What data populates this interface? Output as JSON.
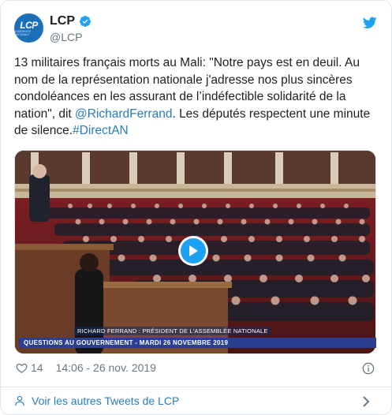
{
  "author": {
    "display_name": "LCP",
    "handle": "@LCP",
    "avatar_text": "LCP",
    "avatar_subtext": "assemblée nationale"
  },
  "tweet": {
    "text_before_mention": "13 militaires français morts au Mali: \"Notre pays est en deuil. Au nom de la représentation nationale j'adresse nos plus sincères condoléances en les assurant de l’indéfectible solidarité de la nation\", dit ",
    "mention": "@RichardFerrand",
    "text_after_mention": ". Les députés respectent une minute de silence.",
    "hashtag": "#DirectAN"
  },
  "media": {
    "caption_name": "RICHARD FERRAND : PRÉSIDENT DE L'ASSEMBLÉE NATIONALE",
    "caption_band": "QUESTIONS AU GOUVERNEMENT - MARDI 26 NOVEMBRE 2019"
  },
  "meta": {
    "like_count": "14",
    "timestamp": "14:06 - 26 nov. 2019"
  },
  "footer": {
    "more_tweets_label": "Voir les autres Tweets de LCP"
  },
  "colors": {
    "link": "#2b7bb9",
    "twitter_blue": "#1da1f2",
    "brand": "#1a6fb8",
    "meta_gray": "#697882"
  },
  "icons": [
    "verified-badge-icon",
    "twitter-bird-icon",
    "play-icon",
    "heart-icon",
    "info-icon",
    "person-icon",
    "chevron-right-icon"
  ]
}
